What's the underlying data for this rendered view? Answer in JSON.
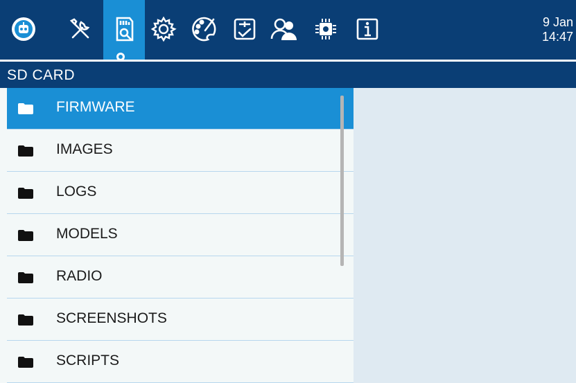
{
  "header": {
    "tabs": [
      {
        "name": "radio-home-icon"
      },
      {
        "name": "tools-icon"
      },
      {
        "name": "sdcard-icon",
        "selected": true
      },
      {
        "name": "settings-gear-icon"
      },
      {
        "name": "theme-palette-icon"
      },
      {
        "name": "checklist-icon"
      },
      {
        "name": "users-icon"
      },
      {
        "name": "hardware-chip-icon"
      },
      {
        "name": "info-icon"
      }
    ],
    "date": "9 Jan",
    "time": "14:47"
  },
  "page": {
    "title": "SD CARD"
  },
  "files": [
    {
      "label": "FIRMWARE",
      "selected": true
    },
    {
      "label": "IMAGES"
    },
    {
      "label": "LOGS"
    },
    {
      "label": "MODELS"
    },
    {
      "label": "RADIO"
    },
    {
      "label": "SCREENSHOTS"
    },
    {
      "label": "SCRIPTS"
    }
  ],
  "colors": {
    "header_bg": "#0a3e75",
    "selected": "#1a8fd5",
    "list_bg": "#f3f8f8",
    "divider": "#b6d6ee",
    "pane_bg": "#dfeaf2"
  }
}
